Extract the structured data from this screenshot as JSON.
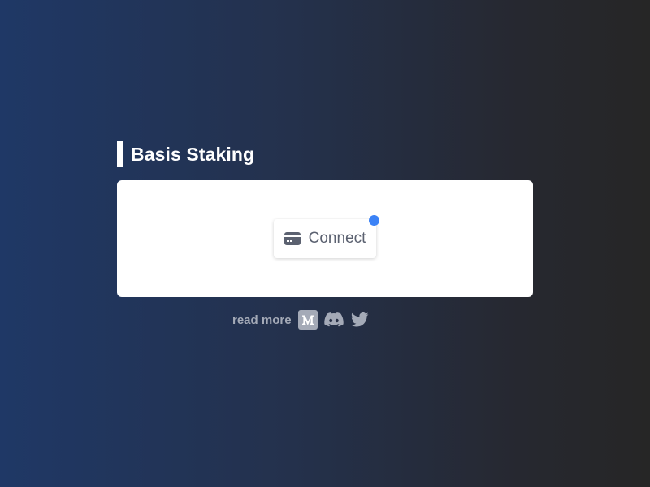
{
  "page": {
    "title": "Basis Staking"
  },
  "card": {
    "connect_label": "Connect",
    "connect_icon": "wallet-card-icon",
    "status_dot_color": "#3b82f6"
  },
  "footer": {
    "read_more_label": "read more",
    "links": [
      {
        "icon": "medium-icon"
      },
      {
        "icon": "discord-icon"
      },
      {
        "icon": "twitter-icon"
      }
    ]
  },
  "colors": {
    "background_start": "#1f3866",
    "background_end": "#262626",
    "muted_text": "#a4aab7",
    "button_text": "#5b6170"
  }
}
